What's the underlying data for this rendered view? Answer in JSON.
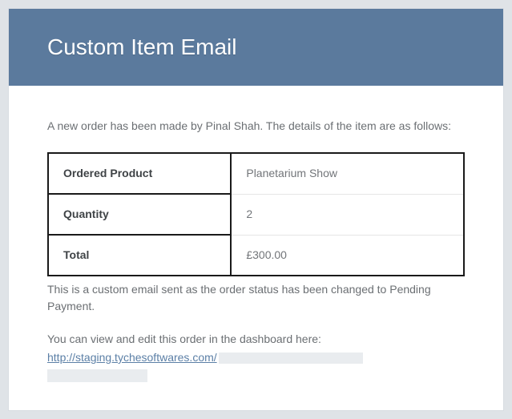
{
  "header": {
    "title": "Custom Item Email"
  },
  "body": {
    "intro": "A new order has been made by Pinal Shah. The details of the item are as follows:",
    "status_note": "This is a custom email sent as the order status has been changed to Pending Payment.",
    "view_prompt": "You can view and edit this order in the dashboard here:",
    "link_text": "http://staging.tychesoftwares.com/"
  },
  "table": {
    "rows": [
      {
        "label": "Ordered Product",
        "value": "Planetarium Show"
      },
      {
        "label": "Quantity",
        "value": "2"
      },
      {
        "label": "Total",
        "value": "£300.00"
      }
    ]
  }
}
